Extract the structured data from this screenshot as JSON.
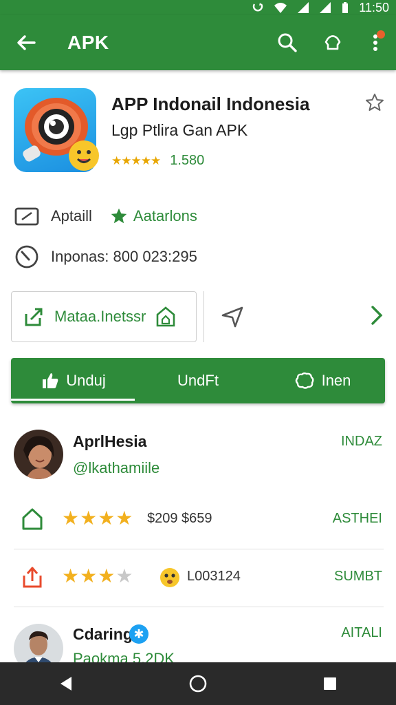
{
  "status_bar": {
    "time": "11:50"
  },
  "app_bar": {
    "title": "APK"
  },
  "app": {
    "name": "APP Indonail Indonesia",
    "subtitle": "Lgp Ptlira Gan APK",
    "rating_stars": "★★★★★",
    "rating_count": "1.580"
  },
  "info": {
    "category_label": "Aptaill",
    "badge_label": "Aatarlons",
    "installs_label": "Inponas: 800 023:295"
  },
  "actions": {
    "card_label": "Mataa.Inetssr"
  },
  "tabs": [
    {
      "label": "Unduj"
    },
    {
      "label": "UndFt"
    },
    {
      "label": "Inen"
    }
  ],
  "reviewer1": {
    "name": "AprlHesia",
    "handle": "@lkathamiile",
    "tag": "INDAZ"
  },
  "review_rows": [
    {
      "stars_filled": "★★★★",
      "stars_empty": "",
      "value": "$209 $659",
      "tag": "ASTHEI"
    },
    {
      "stars_filled": "★★★",
      "stars_empty": "★",
      "value": "L003124",
      "tag": "SUMBT"
    }
  ],
  "reviewer2": {
    "name": "Cdaring",
    "handle": "Paokma 5.2DK",
    "tag": "AITALI"
  },
  "colors": {
    "primary": "#2e8b3a",
    "star": "#f2b01e",
    "nav": "#2a2a2a"
  }
}
